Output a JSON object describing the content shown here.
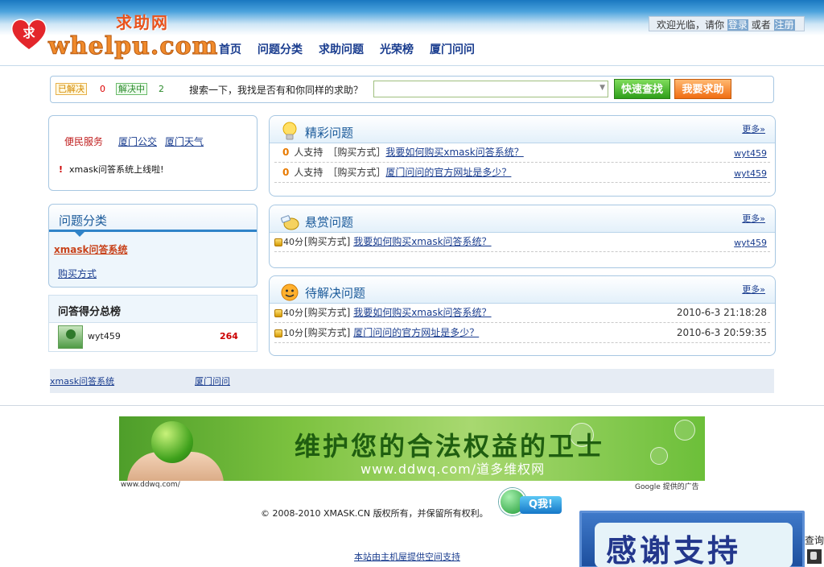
{
  "brand": {
    "name_cn": "求助网",
    "name_en": "whelpu.com",
    "heart_char": "求"
  },
  "nav": [
    "首页",
    "问题分类",
    "求助问题",
    "光荣榜",
    "厦门问问"
  ],
  "login": {
    "prefix": "欢迎光临，请你",
    "login": "登录",
    "or": "或者",
    "register": "注册"
  },
  "stats": {
    "solved_label": "已解决",
    "solved_count": "0",
    "solving_label": "解决中",
    "solving_count": "2"
  },
  "search": {
    "prompt": "搜索一下，我找是否有和你同样的求助？",
    "value": "",
    "btn_search": "快速查找",
    "btn_ask": "我要求助"
  },
  "service": {
    "title": "便民服务",
    "links": [
      "厦门公交",
      "厦门天气"
    ],
    "notice": "xmask问答系统上线啦!"
  },
  "categories": {
    "title": "问题分类",
    "items": [
      "xmask问答系统",
      "购买方式"
    ]
  },
  "ranking": {
    "title": "问答得分总榜",
    "user": "wyt459",
    "points": "264"
  },
  "panels": {
    "featured": {
      "title": "精彩问题",
      "more": "更多»",
      "rows": [
        {
          "zero": "0",
          "support": "人支持",
          "cat": "［购买方式］",
          "q": "我要如何购买xmask问答系统？",
          "user": "wyt459"
        },
        {
          "zero": "0",
          "support": "人支持",
          "cat": "［购买方式］",
          "q": "厦门问问的官方网址是多少？",
          "user": "wyt459"
        }
      ]
    },
    "reward": {
      "title": "悬赏问题",
      "more": "更多»",
      "rows": [
        {
          "pts": "40分",
          "cat": "[购买方式]",
          "q": "我要如何购买xmask问答系统？",
          "user": "wyt459"
        }
      ]
    },
    "pending": {
      "title": "待解决问题",
      "more": "更多»",
      "rows": [
        {
          "pts": "40分",
          "cat": "[购买方式]",
          "q": "我要如何购买xmask问答系统？",
          "date": "2010-6-3 21:18:28"
        },
        {
          "pts": "10分",
          "cat": "[购买方式]",
          "q": "厦门问问的官方网址是多少？",
          "date": "2010-6-3 20:59:35"
        }
      ]
    }
  },
  "footer_links": [
    "xmask问答系统",
    "厦门问问"
  ],
  "ad": {
    "slogan": "维护您的合法权益的卫士",
    "url": "www.ddwq.com/道多维权网",
    "source": "www.ddwq.com/",
    "by": "Google 提供的广告"
  },
  "copyright": "© 2008-2010 XMASK.CN 版权所有，并保留所有权利。",
  "qq": {
    "label": "Q我!"
  },
  "host": "本站由主机屋提供空间支持",
  "thanks": "感谢支持",
  "query": "查询",
  "colors": {
    "nav": "#1a3d8f",
    "accent_orange": "#f08a2b",
    "panel_border": "#a7c7e2",
    "points_red": "#cc0000"
  }
}
